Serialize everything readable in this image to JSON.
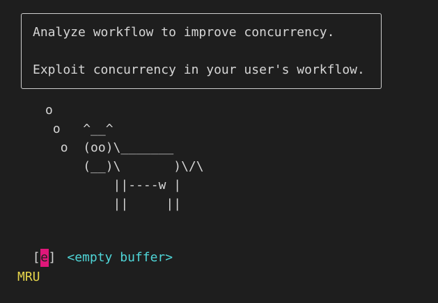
{
  "fortune": {
    "line1": "Analyze workflow to improve concurrency.",
    "line2": "Exploit concurrency in your user's workflow."
  },
  "cowsay": {
    "art": "      o\n       o   ^__^\n        o  (oo)\\_______\n           (__)\\       )\\/\\\n               ||----w |\n               ||     ||"
  },
  "startify": {
    "bracket_open": "[",
    "key": "e",
    "bracket_close": "]",
    "buffer_label": "<empty buffer>",
    "section_header": "MRU"
  },
  "colors": {
    "background": "#1e1e1e",
    "text": "#d6d6d6",
    "key_highlight": "#e0177a",
    "buffer_label": "#4fd6d8",
    "section_header": "#e6d54b"
  }
}
